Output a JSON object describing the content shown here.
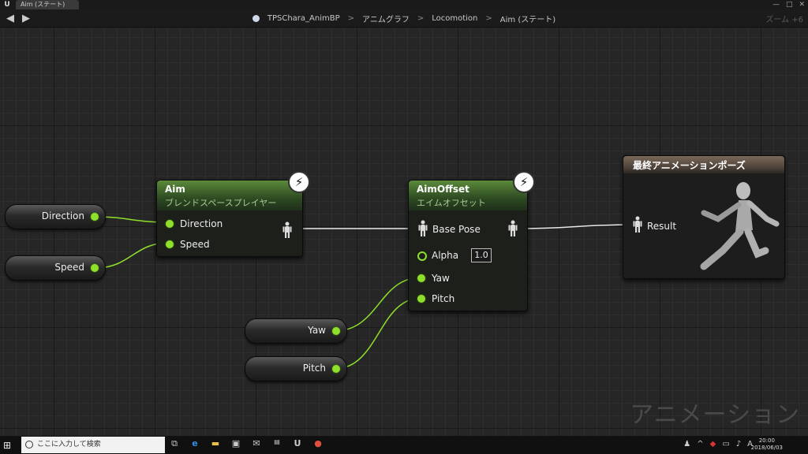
{
  "window": {
    "tab_title": "Aim (ステート)",
    "logo": "U",
    "buttons": [
      "—",
      "□",
      "✕"
    ]
  },
  "nav": {
    "back": "◀",
    "forward": "▶",
    "breadcrumb_root": "TPSChara_AnimBP",
    "breadcrumb_1": "アニムグラフ",
    "breadcrumb_2": "Locomotion",
    "breadcrumb_3": "Aim (ステート)",
    "sep": ">",
    "zoom": "ズーム +6"
  },
  "graph": {
    "vars": {
      "direction": "Direction",
      "speed": "Speed",
      "yaw": "Yaw",
      "pitch": "Pitch"
    },
    "aim_node": {
      "title": "Aim",
      "subtitle": "ブレンドスペースプレイヤー",
      "pin_direction": "Direction",
      "pin_speed": "Speed",
      "bolt": "⚡"
    },
    "aimoffset_node": {
      "title": "AimOffset",
      "subtitle": "エイムオフセット",
      "pin_base_pose": "Base Pose",
      "pin_alpha": "Alpha",
      "alpha_value": "1.0",
      "pin_yaw": "Yaw",
      "pin_pitch": "Pitch",
      "bolt": "⚡"
    },
    "final_node": {
      "title": "最終アニメーションポーズ",
      "pin_result": "Result"
    },
    "watermark": "アニメーション",
    "colors": {
      "float_pin": "#8fe02a",
      "pose_wire": "#e8e8e8",
      "grid_bg": "#262626"
    }
  },
  "taskbar": {
    "start_icon": "windows-icon",
    "search_placeholder": "ここに入力して検索",
    "apps": [
      "task-view-icon",
      "edge-icon",
      "explorer-icon",
      "store-icon",
      "mail-icon",
      "epic-icon",
      "unreal-icon",
      "chrome-icon"
    ],
    "time": "20:00",
    "date": "2018/06/03"
  }
}
